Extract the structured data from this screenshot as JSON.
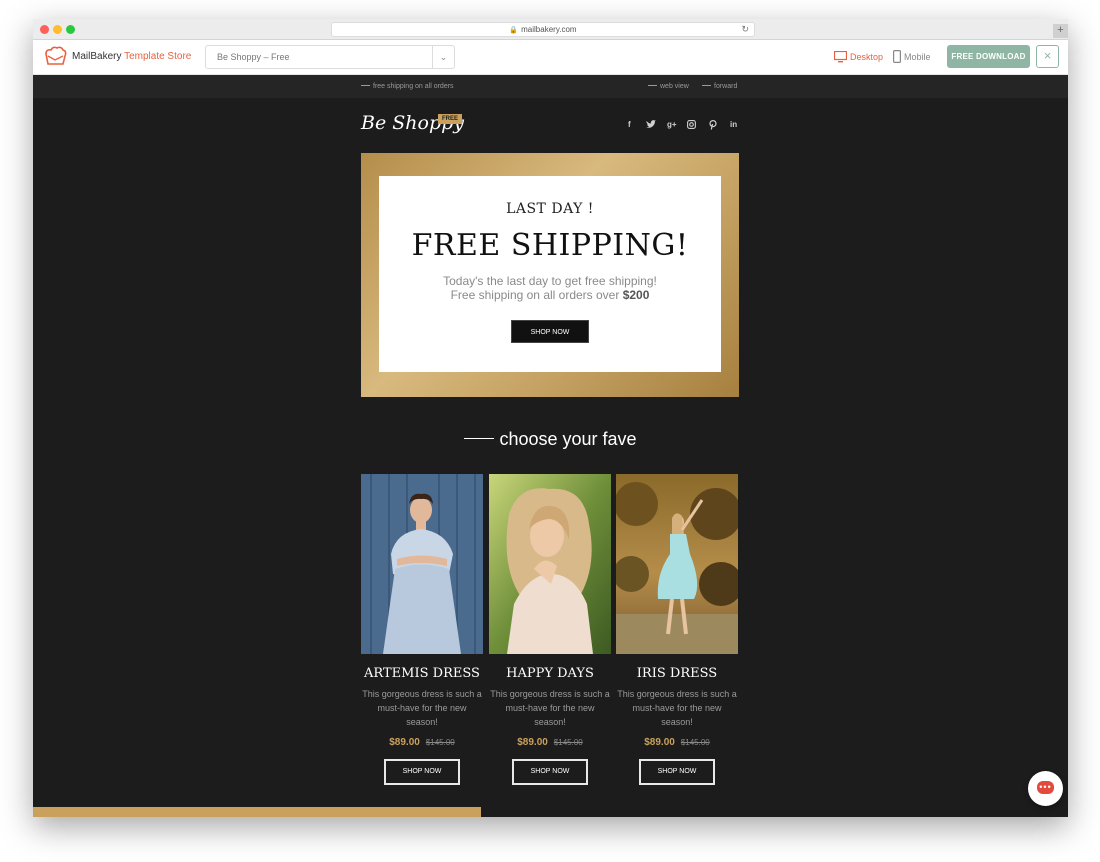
{
  "browser": {
    "url": "mailbakery.com",
    "new_tab": "+"
  },
  "store": {
    "brand_name": "MailBakery",
    "brand_store": "Template Store",
    "template_select": "Be Shoppy – Free",
    "device_desktop": "Desktop",
    "device_mobile": "Mobile",
    "download_button": "FREE DOWNLOAD",
    "close_icon": "×"
  },
  "preheader": {
    "left": "free shipping on all orders",
    "web_view": "web view",
    "forward": "forward"
  },
  "header": {
    "logo": "Be Shoppy",
    "badge": "FREE",
    "social": [
      "f",
      "t",
      "g+",
      "ig",
      "p",
      "in"
    ]
  },
  "hero": {
    "small_title": "LAST DAY !",
    "big_title": "FREE SHIPPING!",
    "line1": "Today's the last day to get free shipping!",
    "line2_prefix": "Free shipping on all orders over ",
    "line2_amount": "$200",
    "button": "SHOP NOW"
  },
  "section": {
    "title": "choose your fave"
  },
  "products": [
    {
      "name": "ARTEMIS DRESS",
      "desc_line1": "This gorgeous dress is such a",
      "desc_line2": "must-have for the new season!",
      "price": "$89.00",
      "old_price": "$145.00",
      "button": "SHOP NOW"
    },
    {
      "name": "HAPPY DAYS",
      "desc_line1": "This gorgeous dress is such a",
      "desc_line2": "must-have for the new season!",
      "price": "$89.00",
      "old_price": "$145.00",
      "button": "SHOP NOW"
    },
    {
      "name": "IRIS DRESS",
      "desc_line1": "This gorgeous dress is such a",
      "desc_line2": "must-have for the new season!",
      "price": "$89.00",
      "old_price": "$145.00",
      "button": "SHOP NOW"
    }
  ],
  "chat": {
    "dots": "•••"
  },
  "colors": {
    "accent_gold": "#c9a15c",
    "brand_orange": "#e8623f",
    "download_green": "#8fb6a5",
    "email_background": "#1c1c1c"
  }
}
